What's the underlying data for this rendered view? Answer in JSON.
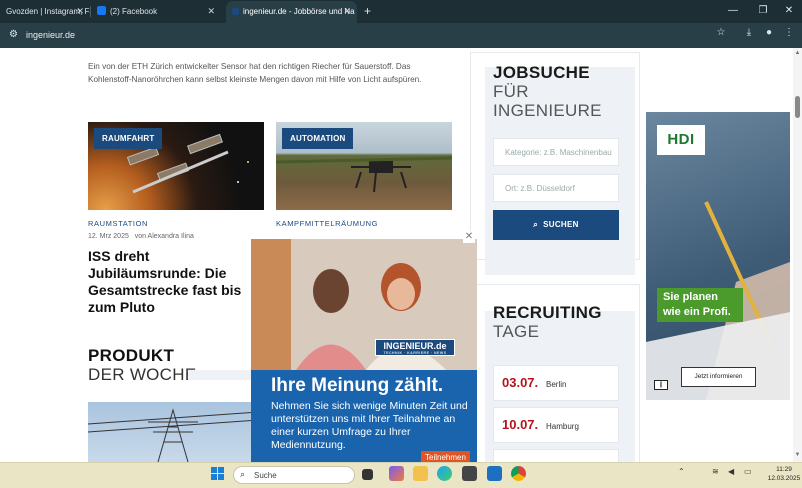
{
  "browser": {
    "tabs": [
      {
        "label": "Gvozden | Instagram, Fa",
        "favicon": "instagram"
      },
      {
        "label": "(2) Facebook",
        "favicon": "facebook"
      },
      {
        "label": "ingenieur.de - Jobbörse und Na",
        "favicon": "ingenieur"
      }
    ],
    "url": "ingenieur.de"
  },
  "article": {
    "intro": "Ein von der ETH Zürich entwickelter Sensor hat den richtigen Riecher für Sauerstoff. Das Kohlenstoff-Nanoröhrchen kann selbst kleinste Mengen davon mit Hilfe von Licht aufspüren.",
    "cards": [
      {
        "badge": "RAUMFAHRT",
        "category": "RAUMSTATION",
        "date": "12. Mrz 2025",
        "author": "von Alexandra Ilina",
        "title": "ISS dreht Jubiläumsrunde: Die Gesamtstrecke fast bis zum Pluto"
      },
      {
        "badge": "AUTOMATION",
        "category": "KAMPFMITTELRÄUMUNG"
      }
    ],
    "section_bold": "PRODUKT",
    "section_light": "DER WOCHE"
  },
  "jobsearch": {
    "title_bold": "JOBSUCHE",
    "title_light1": "FÜR",
    "title_light2": "INGENIEURE",
    "category_placeholder": "Kategorie: z.B. Maschinenbau",
    "location_placeholder": "Ort: z.B. Düsseldorf",
    "search_label": "SUCHEN"
  },
  "recruiting": {
    "title_bold": "RECRUITING",
    "title_light": "TAGE",
    "dates": [
      {
        "date": "03.07.",
        "city": "Berlin"
      },
      {
        "date": "10.07.",
        "city": "Hamburg"
      }
    ]
  },
  "ad": {
    "brand": "HDI",
    "slogan": "Sie planen wie ein Profi.",
    "cta": "Jetzt informieren",
    "info_icon": "||"
  },
  "survey": {
    "logo": "INGENIEUR.de",
    "logo_tag": "TECHNIK · KARRIERE · NEWS",
    "headline": "Ihre Meinung zählt.",
    "text": "Nehmen Sie sich wenige Minuten Zeit und unterstützen uns mit Ihrer Teilnahme an einer kurzen Umfrage zu Ihrer Mediennutzung.",
    "button": "Teilnehmen"
  },
  "taskbar": {
    "search_placeholder": "Suche",
    "time": "11:29",
    "date": "12.03.2025"
  },
  "colors": {
    "brand_blue": "#1b4a7e",
    "accent_red": "#b3141e",
    "chrome_bg": "#293f47",
    "popup_blue": "#1a63ad",
    "hdi_green": "#4a9a2c"
  }
}
